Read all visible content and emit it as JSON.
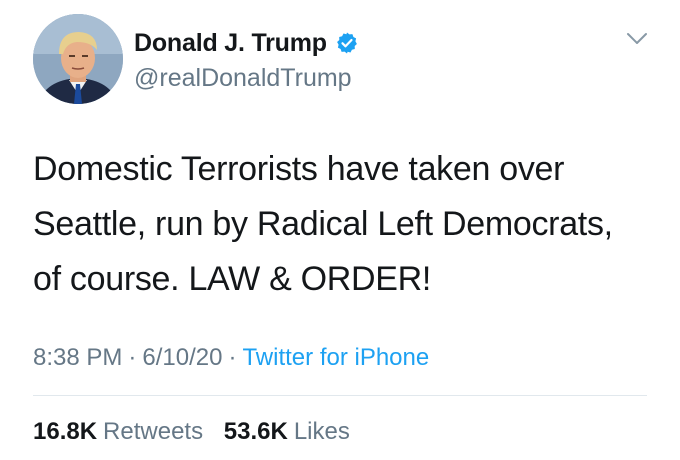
{
  "colors": {
    "text": "#14171a",
    "secondary": "#657786",
    "link": "#1da1f2",
    "verified": "#1da1f2",
    "divider": "#e1e8ed"
  },
  "author": {
    "display_name": "Donald J. Trump",
    "handle": "@realDonaldTrump",
    "avatar_icon": "profile-photo",
    "verified_icon": "verified-badge-icon"
  },
  "menu_icon": "chevron-down-icon",
  "tweet": {
    "lines": [
      "Domestic Terrorists have taken over",
      "Seattle, run by Radical Left Democrats,",
      "of course. LAW & ORDER!"
    ]
  },
  "meta": {
    "time": "8:38 PM",
    "separator": "·",
    "date": "6/10/20",
    "source": "Twitter for iPhone"
  },
  "stats": {
    "retweets": {
      "count": "16.8K",
      "label": "Retweets"
    },
    "likes": {
      "count": "53.6K",
      "label": "Likes"
    }
  }
}
